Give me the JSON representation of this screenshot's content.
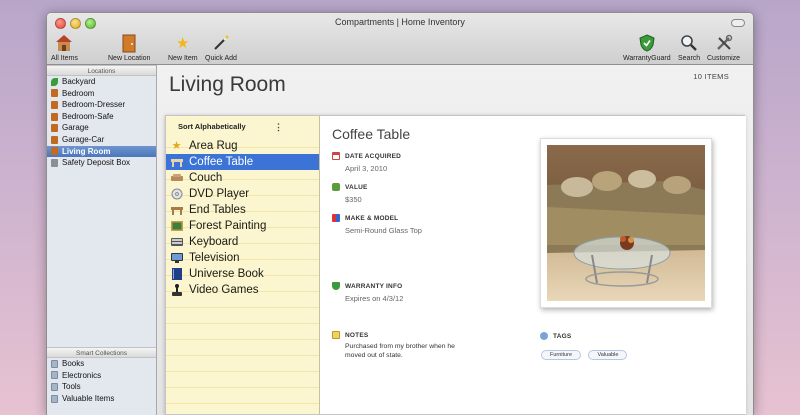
{
  "window": {
    "title": "Compartments | Home Inventory"
  },
  "toolbar": {
    "all_items": "All Items",
    "new_location": "New Location",
    "new_item": "New Item",
    "quick_add": "Quick Add",
    "warranty_guard": "WarrantyGuard",
    "search": "Search",
    "customize": "Customize"
  },
  "sidebar": {
    "locations_header": "Locations",
    "locations": [
      {
        "label": "Backyard",
        "icon": "leaf-icon"
      },
      {
        "label": "Bedroom",
        "icon": "door-icon"
      },
      {
        "label": "Bedroom-Dresser",
        "icon": "door-icon"
      },
      {
        "label": "Bedroom-Safe",
        "icon": "door-icon"
      },
      {
        "label": "Garage",
        "icon": "door-icon"
      },
      {
        "label": "Garage-Car",
        "icon": "door-icon"
      },
      {
        "label": "Living Room",
        "icon": "door-icon",
        "selected": true
      },
      {
        "label": "Safety Deposit Box",
        "icon": "box-icon"
      }
    ],
    "smart_header": "Smart Collections",
    "smart": [
      {
        "label": "Books",
        "icon": "folder-icon"
      },
      {
        "label": "Electronics",
        "icon": "folder-icon"
      },
      {
        "label": "Tools",
        "icon": "folder-icon"
      },
      {
        "label": "Valuable Items",
        "icon": "folder-icon"
      }
    ]
  },
  "main": {
    "title": "Living Room",
    "count": "10 ITEMS",
    "sort_label": "Sort Alphabetically",
    "sort_dots": "⋮",
    "items": [
      {
        "label": "Area Rug",
        "icon": "star-icon"
      },
      {
        "label": "Coffee Table",
        "icon": "table-icon",
        "selected": true
      },
      {
        "label": "Couch",
        "icon": "couch-icon"
      },
      {
        "label": "DVD Player",
        "icon": "disc-icon"
      },
      {
        "label": "End Tables",
        "icon": "table-icon"
      },
      {
        "label": "Forest Painting",
        "icon": "painting-icon"
      },
      {
        "label": "Keyboard",
        "icon": "keyboard-icon"
      },
      {
        "label": "Television",
        "icon": "tv-icon"
      },
      {
        "label": "Universe Book",
        "icon": "book-icon"
      },
      {
        "label": "Video Games",
        "icon": "joystick-icon"
      }
    ]
  },
  "detail": {
    "name": "Coffee Table",
    "date_label": "DATE ACQUIRED",
    "date_value": "April 3, 2010",
    "value_label": "VALUE",
    "value_value": "$350",
    "make_label": "MAKE & MODEL",
    "make_value": "Semi-Round Glass Top",
    "warranty_label": "WARRANTY INFO",
    "warranty_value": "Expires on 4/3/12",
    "notes_label": "NOTES",
    "notes_value": "Purchased from my brother when he moved out of state.",
    "tags_label": "TAGS",
    "tags": [
      "Furniture",
      "Valuable"
    ]
  },
  "colors": {
    "selection": "#3b74d6",
    "sidebar_selection": "#5581c4",
    "list_background": "#fbf6cf"
  }
}
